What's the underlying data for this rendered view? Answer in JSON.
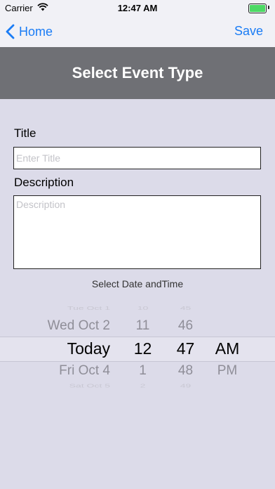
{
  "status_bar": {
    "carrier": "Carrier",
    "time": "12:47 AM",
    "battery_level": 1.0
  },
  "nav": {
    "back_label": "Home",
    "save_label": "Save"
  },
  "header": {
    "title": "Select Event Type"
  },
  "form": {
    "title_label": "Title",
    "title_value": "",
    "title_placeholder": "Enter Title",
    "description_label": "Description",
    "description_value": "",
    "description_placeholder": "Description",
    "datetime_caption": "Select Date andTime"
  },
  "picker": {
    "dates": [
      "Tue Oct 1",
      "Wed Oct 2",
      "Today",
      "Fri Oct 4",
      "Sat Oct 5"
    ],
    "hours": [
      "10",
      "11",
      "12",
      "1",
      "2"
    ],
    "minutes": [
      "45",
      "46",
      "47",
      "48",
      "49"
    ],
    "ampm": [
      "",
      "",
      "AM",
      "PM",
      ""
    ]
  },
  "colors": {
    "accent": "#1a7cf5",
    "banner": "#6f7075",
    "background": "#dcdbe9"
  },
  "icons": {
    "back": "chevron-left-icon",
    "wifi": "wifi-icon",
    "battery": "battery-icon"
  }
}
